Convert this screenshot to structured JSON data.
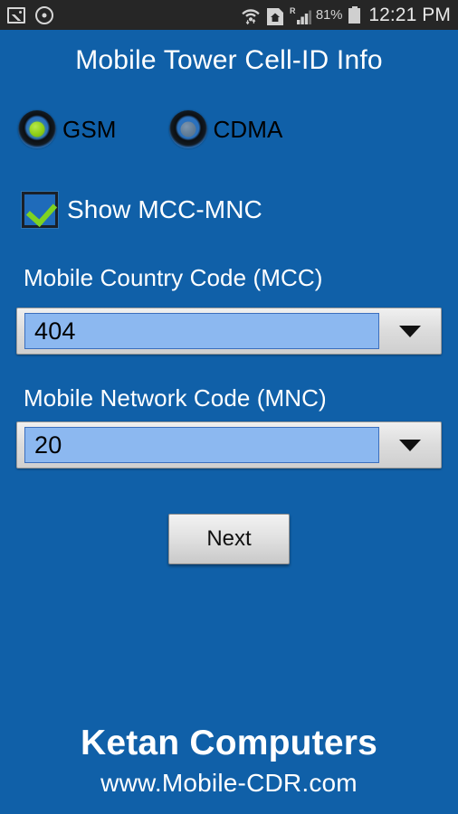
{
  "colors": {
    "background": "#1060A8",
    "statusbar": "#262626",
    "accent_green": "#8ecf16",
    "field_highlight": "#8cb8f0",
    "text_light": "#ffffff"
  },
  "statusbar": {
    "left_icons": [
      "photo-icon",
      "disc-record-icon"
    ],
    "right_icons": [
      "wifi-icon",
      "home-network-icon",
      "signal-roaming-icon",
      "battery-icon"
    ],
    "battery_percent": "81%",
    "clock": "12:21 PM",
    "roaming_indicator": "R"
  },
  "header": {
    "title": "Mobile Tower Cell-ID Info"
  },
  "network_type": {
    "options": [
      {
        "label": "GSM",
        "selected": true
      },
      {
        "label": "CDMA",
        "selected": false
      }
    ]
  },
  "show_mcc_mnc": {
    "label": "Show MCC-MNC",
    "checked": true
  },
  "mcc": {
    "label": "Mobile Country Code (MCC)",
    "value": "404"
  },
  "mnc": {
    "label": "Mobile Network Code (MNC)",
    "value": "20"
  },
  "actions": {
    "next_label": "Next"
  },
  "footer": {
    "brand": "Ketan Computers",
    "url": "www.Mobile-CDR.com"
  }
}
